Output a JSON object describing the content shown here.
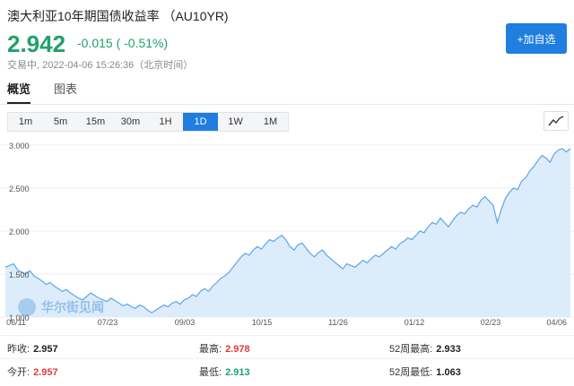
{
  "header": {
    "title": "澳大利亚10年期国债收益率 （AU10YR)",
    "price": "2.942",
    "change": "-0.015 ( -0.51%)",
    "status": "交易中",
    "timestamp": "2022-04-06 15:26:36（北京时间）",
    "add_button": "+加自选"
  },
  "tabs": [
    {
      "label": "概览",
      "active": true
    },
    {
      "label": "图表",
      "active": false
    }
  ],
  "periods": [
    {
      "label": "1m",
      "active": false
    },
    {
      "label": "5m",
      "active": false
    },
    {
      "label": "15m",
      "active": false
    },
    {
      "label": "30m",
      "active": false
    },
    {
      "label": "1H",
      "active": false
    },
    {
      "label": "1D",
      "active": true
    },
    {
      "label": "1W",
      "active": false
    },
    {
      "label": "1M",
      "active": false
    }
  ],
  "chart_type_icon": "line-chart-icon",
  "watermark": "华尔街见闻",
  "stats": {
    "prev_close_label": "昨收:",
    "prev_close": "2.957",
    "open_label": "今开:",
    "open": "2.957",
    "high_label": "最高:",
    "high": "2.978",
    "low_label": "最低:",
    "low": "2.913",
    "high52_label": "52周最高:",
    "high52": "2.933",
    "low52_label": "52周最低:",
    "low52": "1.063"
  },
  "colors": {
    "up": "#e03c3c",
    "down": "#22a06b",
    "accent": "#1f7ee0",
    "line": "#5ba6ea",
    "area": "#dcecfb"
  },
  "chart_data": {
    "type": "area",
    "ylim": [
      1.0,
      3.0
    ],
    "y_ticks": [
      "3.000",
      "2.500",
      "2.000",
      "1.500",
      "1.000"
    ],
    "x_ticks": [
      "06/11",
      "07/23",
      "09/03",
      "10/15",
      "11/26",
      "01/12",
      "02/23",
      "04/06"
    ],
    "values": [
      1.58,
      1.6,
      1.62,
      1.55,
      1.52,
      1.5,
      1.54,
      1.48,
      1.45,
      1.42,
      1.38,
      1.4,
      1.36,
      1.33,
      1.3,
      1.32,
      1.28,
      1.25,
      1.22,
      1.2,
      1.24,
      1.28,
      1.25,
      1.22,
      1.2,
      1.18,
      1.22,
      1.19,
      1.16,
      1.13,
      1.15,
      1.12,
      1.1,
      1.14,
      1.12,
      1.08,
      1.05,
      1.08,
      1.11,
      1.14,
      1.12,
      1.16,
      1.18,
      1.15,
      1.2,
      1.22,
      1.26,
      1.24,
      1.3,
      1.33,
      1.3,
      1.36,
      1.4,
      1.45,
      1.48,
      1.52,
      1.58,
      1.64,
      1.7,
      1.74,
      1.72,
      1.78,
      1.82,
      1.79,
      1.85,
      1.9,
      1.88,
      1.92,
      1.95,
      1.9,
      1.82,
      1.78,
      1.84,
      1.86,
      1.8,
      1.74,
      1.7,
      1.75,
      1.78,
      1.72,
      1.68,
      1.64,
      1.6,
      1.56,
      1.62,
      1.6,
      1.58,
      1.62,
      1.66,
      1.63,
      1.68,
      1.72,
      1.7,
      1.74,
      1.78,
      1.82,
      1.79,
      1.85,
      1.88,
      1.92,
      1.9,
      1.95,
      2.0,
      1.98,
      2.05,
      2.1,
      2.08,
      2.15,
      2.1,
      2.05,
      2.12,
      2.18,
      2.22,
      2.2,
      2.26,
      2.3,
      2.28,
      2.36,
      2.4,
      2.35,
      2.3,
      2.1,
      2.25,
      2.38,
      2.45,
      2.5,
      2.48,
      2.58,
      2.62,
      2.7,
      2.75,
      2.82,
      2.88,
      2.85,
      2.8,
      2.9,
      2.94,
      2.96,
      2.92,
      2.96
    ]
  }
}
